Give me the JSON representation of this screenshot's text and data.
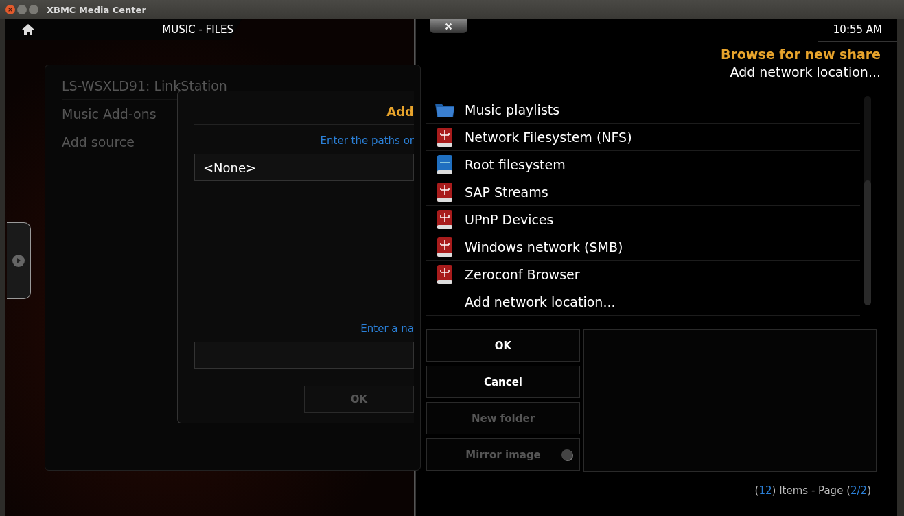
{
  "window": {
    "title": "XBMC Media Center"
  },
  "header": {
    "title": "MUSIC - FILES"
  },
  "sources": [
    {
      "label": "LS-WSXLD91: LinkStation"
    },
    {
      "label": "Music Add-ons"
    },
    {
      "label": "Add source"
    }
  ],
  "add_source_dialog": {
    "title": "Add",
    "paths_prompt": "Enter the paths or",
    "path_value": "<None>",
    "name_prompt": "Enter a na",
    "ok_button": {
      "label": "OK",
      "disabled": true
    }
  },
  "browser": {
    "clock": "10:55 AM",
    "heading": "Browse for new share",
    "subheading": "Add network location...",
    "items": [
      {
        "label": "Music playlists",
        "kind": "folder"
      },
      {
        "label": "Network Filesystem (NFS)",
        "kind": "network-drive"
      },
      {
        "label": "Root filesystem",
        "kind": "local-drive"
      },
      {
        "label": "SAP Streams",
        "kind": "network-drive"
      },
      {
        "label": "UPnP Devices",
        "kind": "network-drive"
      },
      {
        "label": "Windows network (SMB)",
        "kind": "network-drive"
      },
      {
        "label": "Zeroconf Browser",
        "kind": "network-drive"
      },
      {
        "label": "Add network location...",
        "kind": "none"
      }
    ],
    "buttons": [
      {
        "label": "OK",
        "disabled": false,
        "kind": "button"
      },
      {
        "label": "Cancel",
        "disabled": false,
        "kind": "button"
      },
      {
        "label": "New folder",
        "disabled": true,
        "kind": "button"
      },
      {
        "label": "Mirror image",
        "disabled": true,
        "kind": "toggle",
        "on": false
      }
    ],
    "footer": [
      {
        "text": "(",
        "highlight": false
      },
      {
        "text": "12",
        "highlight": true
      },
      {
        "text": ") Items - Page (",
        "highlight": false
      },
      {
        "text": "2/2",
        "highlight": true
      },
      {
        "text": ")",
        "highlight": false
      }
    ]
  }
}
